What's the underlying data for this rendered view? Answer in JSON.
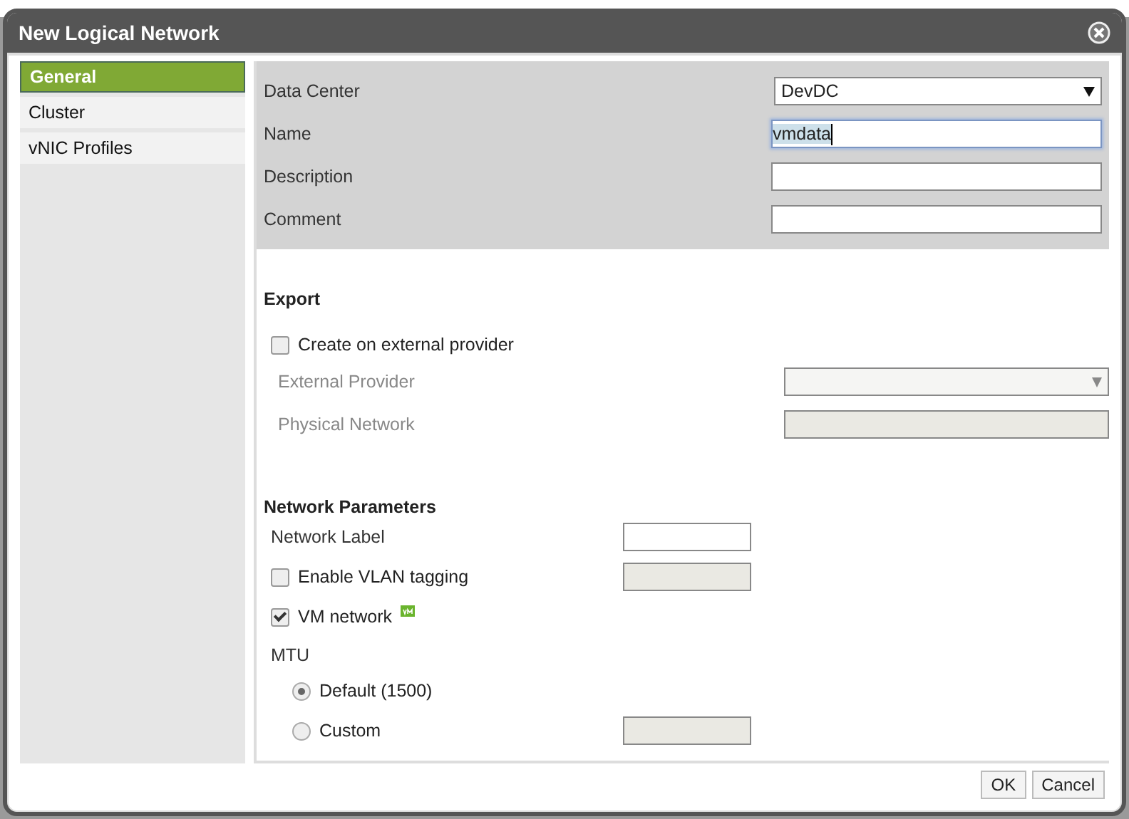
{
  "window": {
    "title": "New Logical Network"
  },
  "sidebar": {
    "items": [
      {
        "label": "General",
        "selected": true
      },
      {
        "label": "Cluster",
        "selected": false
      },
      {
        "label": "vNIC Profiles",
        "selected": false
      }
    ]
  },
  "general": {
    "fields": [
      {
        "kind": "select",
        "label": "Data Center",
        "value": "DevDC"
      },
      {
        "kind": "text",
        "label": "Name",
        "value": "vmdata",
        "focused": true
      },
      {
        "kind": "text",
        "label": "Description",
        "focused": false
      },
      {
        "kind": "text",
        "label": "Comment",
        "focused": false
      }
    ]
  },
  "export": {
    "title": "Export",
    "create_on_external_provider": {
      "label": "Create on external provider",
      "checked": false
    },
    "fields": [
      {
        "kind": "select",
        "label": "External Provider",
        "disabled": true
      },
      {
        "kind": "text",
        "label": "Physical Network",
        "disabled": true
      }
    ]
  },
  "network_parameters": {
    "title": "Network Parameters",
    "network_label": {
      "label": "Network Label",
      "disabled": false
    },
    "vlan_tagging": {
      "label": "Enable VLAN tagging",
      "checked": false,
      "input_disabled": true
    },
    "vm_network": {
      "label": "VM network",
      "checked": true
    },
    "mtu": {
      "label": "MTU",
      "options": [
        {
          "label": "Default (1500)",
          "selected": true,
          "has_input": false
        },
        {
          "label": "Custom",
          "selected": false,
          "has_input": true
        }
      ]
    }
  },
  "buttons": [
    "OK",
    "Cancel"
  ]
}
